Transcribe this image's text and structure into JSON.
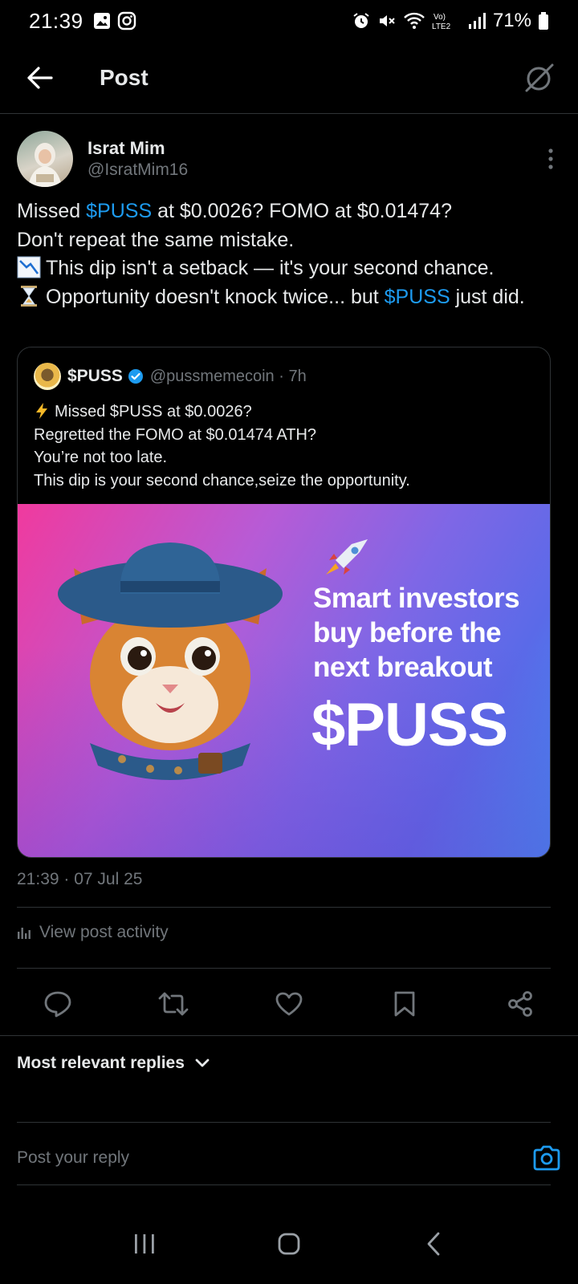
{
  "status_bar": {
    "time": "21:39",
    "battery": "71%",
    "icons": [
      "gallery-icon",
      "instagram-icon",
      "alarm-icon",
      "mute-icon",
      "wifi-icon",
      "volte-icon",
      "signal-icon",
      "battery-icon"
    ]
  },
  "header": {
    "title": "Post"
  },
  "post": {
    "author_name": "Israt Mim",
    "author_handle": "@IsratMim16",
    "text": {
      "line1_a": "Missed ",
      "line1_tag": "$PUSS",
      "line1_b": " at $0.0026? FOMO at $0.01474?",
      "line2": "Don't repeat the same mistake.",
      "line3": "This dip isn't a setback — it's your second chance.",
      "line4_a": "Opportunity doesn't knock twice... but ",
      "line4_tag": "$PUSS",
      "line4_b": " just did."
    },
    "timestamp": "21:39 · 07 Jul 25",
    "view_activity": "View post activity"
  },
  "quote": {
    "name": "$PUSS",
    "handle_time": "@pussmemecoin · 7h",
    "line1": "Missed $PUSS at $0.0026?",
    "line2": "Regretted the FOMO at $0.01474 ATH?",
    "line3": "You’re not too late.",
    "line4": "This dip is your second chance,seize the opportunity.",
    "image": {
      "headline_1": "Smart investors",
      "headline_2": "buy before the",
      "headline_3": "next breakout",
      "ticker": "$PUSS"
    }
  },
  "replies": {
    "sort_label": "Most relevant replies",
    "placeholder": "Post your reply"
  },
  "colors": {
    "accent": "#1d9bf0",
    "muted": "#71767b",
    "text": "#e7e9ea",
    "background": "#000000",
    "border": "#2f3336"
  }
}
